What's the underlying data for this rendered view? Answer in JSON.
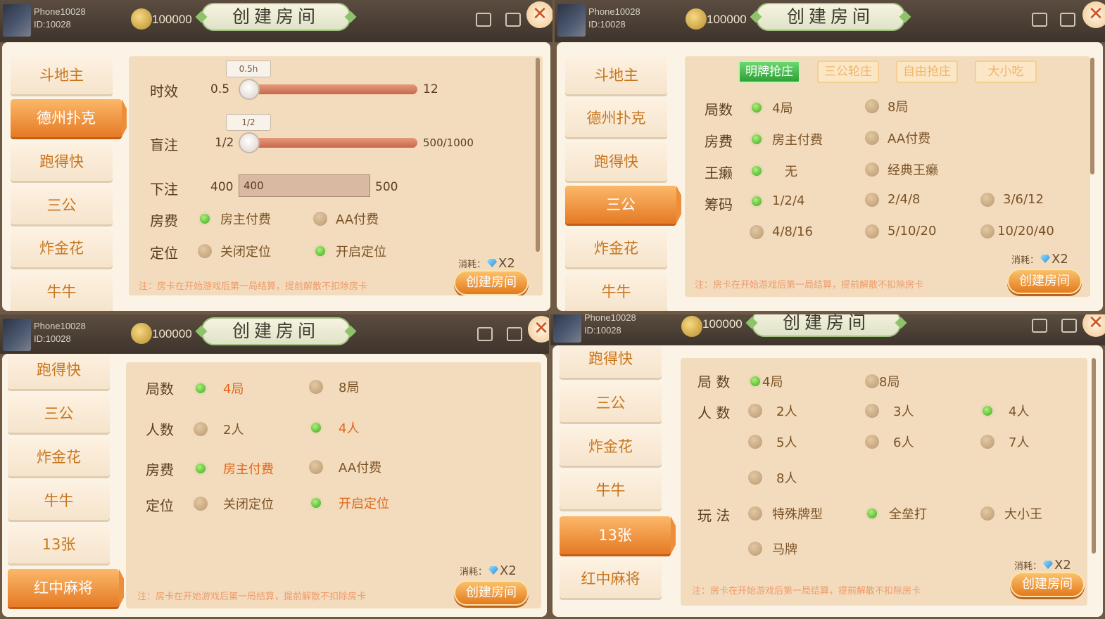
{
  "common": {
    "player_name": "Phone10028",
    "player_id": "ID:10028",
    "coins": "100000",
    "title": "创建房间",
    "note": "注：房卡在开始游戏后第一局结算，提前解散不扣除房卡",
    "cost_label": "消耗：",
    "cost_value": "X2",
    "create_button": "创建房间"
  },
  "p1": {
    "sidebar": [
      "斗地主",
      "德州扑克",
      "跑得快",
      "三公",
      "炸金花",
      "牛牛"
    ],
    "active": "德州扑克",
    "time": {
      "label": "时效",
      "min": "0.5",
      "max": "12",
      "tip": "0.5h"
    },
    "blind": {
      "label": "盲注",
      "min": "1/2",
      "max": "500/1000",
      "tip": "1/2"
    },
    "bet": {
      "label": "下注",
      "min": "400",
      "value": "400",
      "max": "500"
    },
    "fee": {
      "label": "房费",
      "opt1": "房主付费",
      "opt2": "AA付费"
    },
    "loc": {
      "label": "定位",
      "opt1": "关闭定位",
      "opt2": "开启定位"
    }
  },
  "p2": {
    "sidebar": [
      "斗地主",
      "德州扑克",
      "跑得快",
      "三公",
      "炸金花",
      "牛牛"
    ],
    "active": "三公",
    "tabs": [
      "明牌抢庄",
      "三公轮庄",
      "自由抢庄",
      "大小吃"
    ],
    "rounds": {
      "label": "局数",
      "o": [
        "4局",
        "8局"
      ]
    },
    "fee": {
      "label": "房费",
      "o": [
        "房主付费",
        "AA付费"
      ]
    },
    "joker": {
      "label": "王癞",
      "o": [
        "无",
        "经典王癞"
      ]
    },
    "chips": {
      "label": "筹码",
      "o": [
        "1/2/4",
        "2/4/8",
        "3/6/12",
        "4/8/16",
        "5/10/20",
        "10/20/40"
      ]
    }
  },
  "p3": {
    "sidebar": [
      "跑得快",
      "三公",
      "炸金花",
      "牛牛",
      "13张",
      "红中麻将"
    ],
    "active": "红中麻将",
    "rounds": {
      "label": "局数",
      "o": [
        "4局",
        "8局"
      ]
    },
    "players": {
      "label": "人数",
      "o": [
        "2人",
        "4人"
      ]
    },
    "fee": {
      "label": "房费",
      "o": [
        "房主付费",
        "AA付费"
      ]
    },
    "loc": {
      "label": "定位",
      "o": [
        "关闭定位",
        "开启定位"
      ]
    }
  },
  "p4": {
    "sidebar": [
      "跑得快",
      "三公",
      "炸金花",
      "牛牛",
      "13张",
      "红中麻将"
    ],
    "active": "13张",
    "rounds": {
      "label": "局 数",
      "o": [
        "4局",
        "8局"
      ]
    },
    "players": {
      "label": "人 数",
      "o": [
        "2人",
        "3人",
        "4人",
        "5人",
        "6人",
        "7人",
        "8人"
      ]
    },
    "play": {
      "label": "玩 法",
      "o": [
        "特殊牌型",
        "全垒打",
        "大小王",
        "马牌"
      ]
    }
  },
  "colors": {
    "accent": "#e57a25",
    "selected": "#3aa81d",
    "panel": "#f3dcbd"
  }
}
